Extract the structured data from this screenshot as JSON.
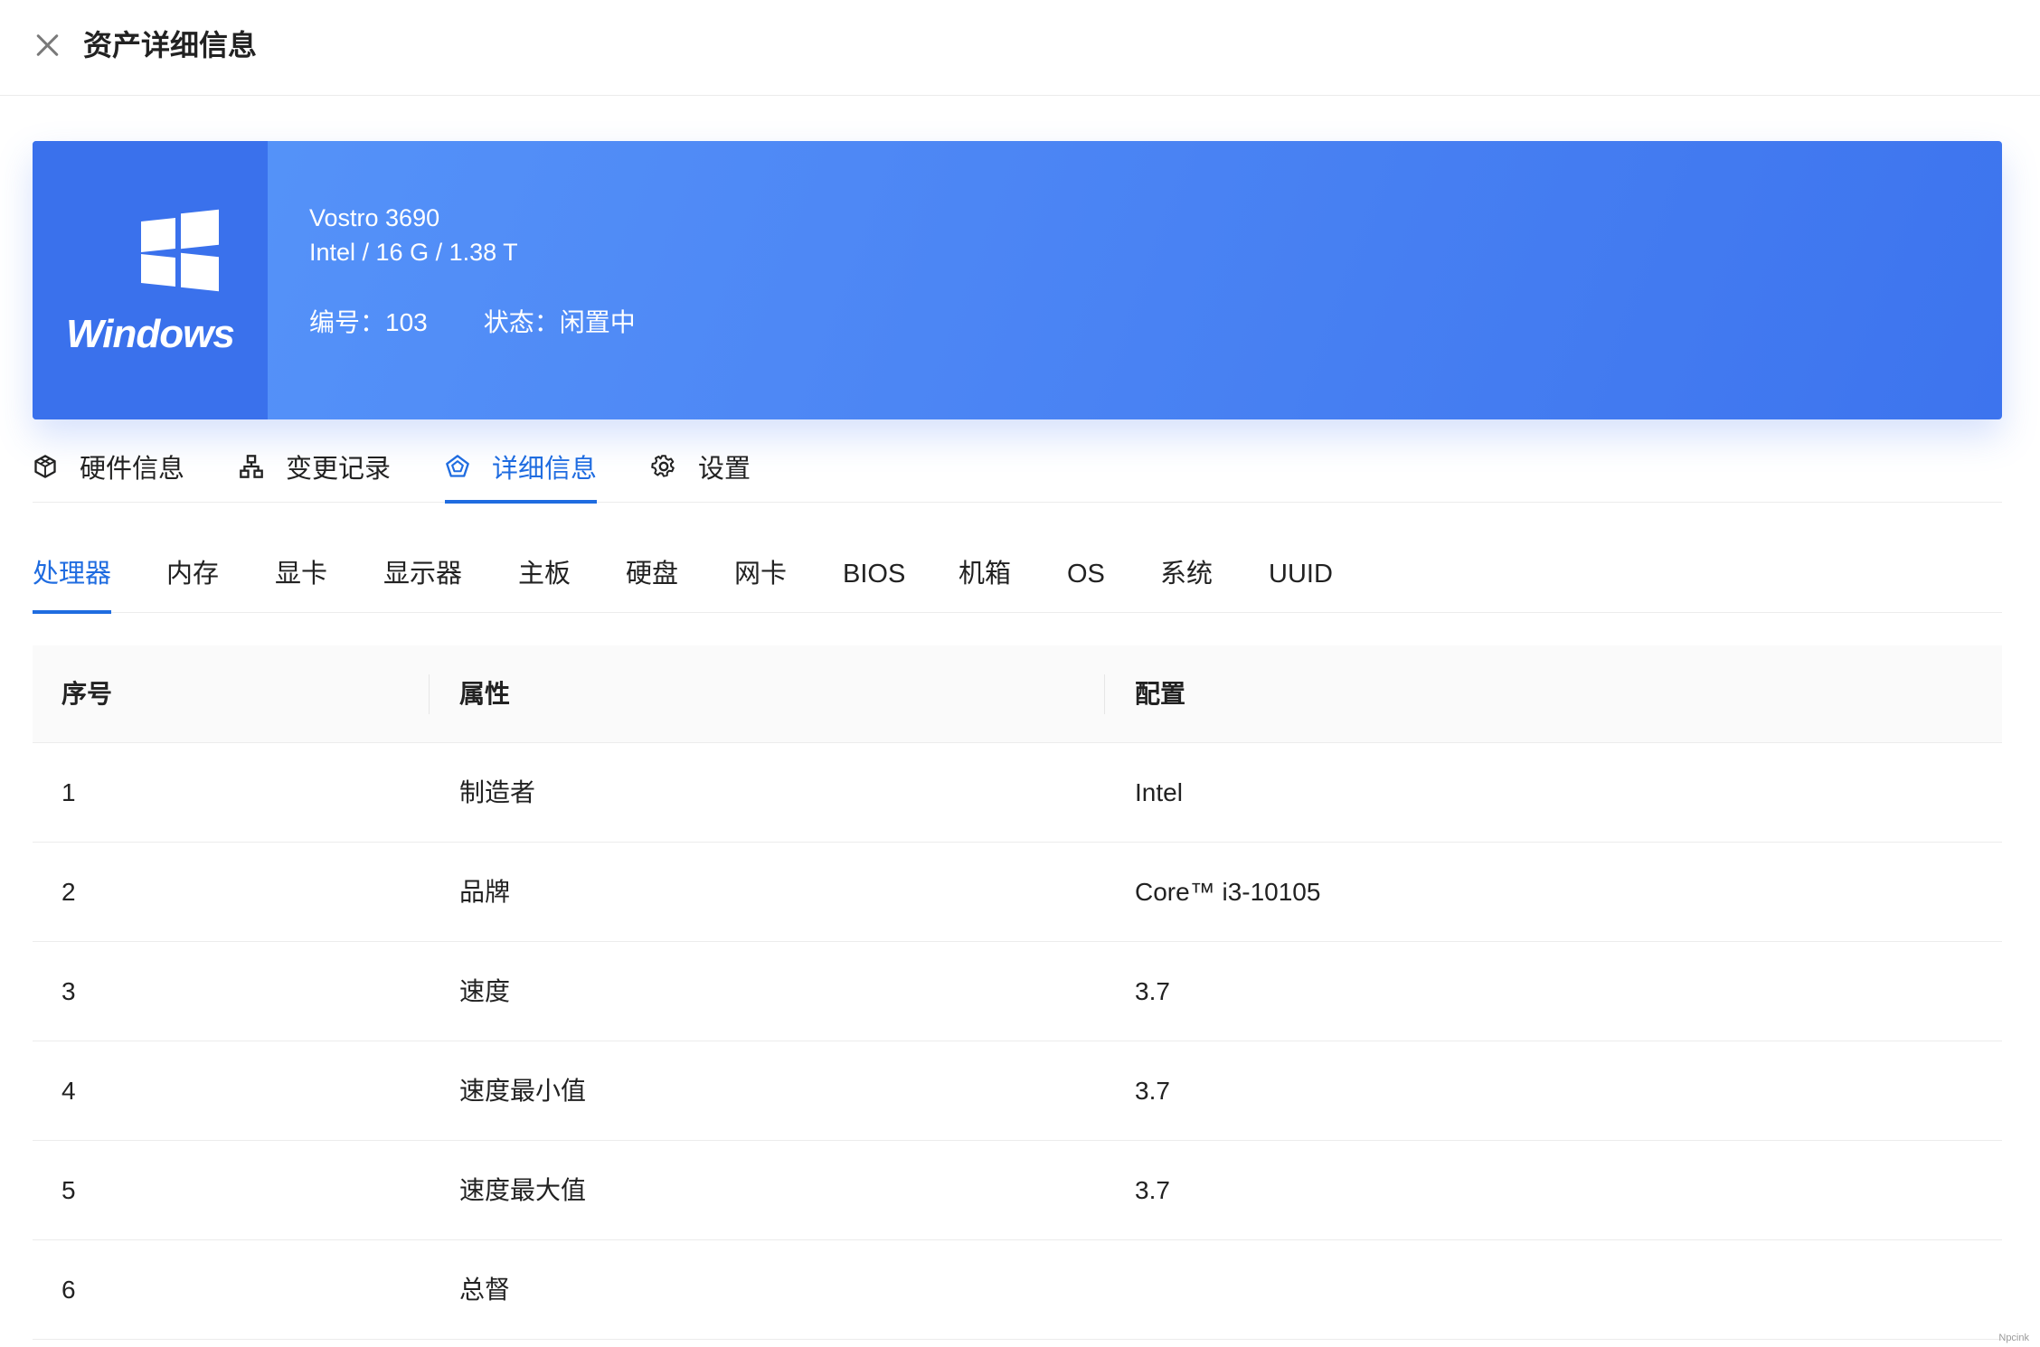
{
  "header": {
    "title": "资产详细信息"
  },
  "asset": {
    "os_name": "Windows",
    "model": "Vostro 3690",
    "spec": "Intel / 16 G / 1.38 T",
    "number_label": "编号：",
    "number_value": "103",
    "status_label": "状态：",
    "status_value": "闲置中"
  },
  "main_tabs": [
    {
      "label": "硬件信息",
      "icon": "cube-icon"
    },
    {
      "label": "变更记录",
      "icon": "hierarchy-icon"
    },
    {
      "label": "详细信息",
      "icon": "pentagon-icon",
      "active": true
    },
    {
      "label": "设置",
      "icon": "gear-icon"
    }
  ],
  "sub_tabs": [
    {
      "label": "处理器",
      "active": true
    },
    {
      "label": "内存"
    },
    {
      "label": "显卡"
    },
    {
      "label": "显示器"
    },
    {
      "label": "主板"
    },
    {
      "label": "硬盘"
    },
    {
      "label": "网卡"
    },
    {
      "label": "BIOS"
    },
    {
      "label": "机箱"
    },
    {
      "label": "OS"
    },
    {
      "label": "系统"
    },
    {
      "label": "UUID"
    }
  ],
  "table": {
    "columns": [
      "序号",
      "属性",
      "配置"
    ],
    "rows": [
      [
        "1",
        "制造者",
        "Intel"
      ],
      [
        "2",
        "品牌",
        "Core™ i3-10105"
      ],
      [
        "3",
        "速度",
        "3.7"
      ],
      [
        "4",
        "速度最小值",
        "3.7"
      ],
      [
        "5",
        "速度最大值",
        "3.7"
      ],
      [
        "6",
        "总督",
        ""
      ]
    ]
  },
  "watermark": "Npcink",
  "colors": {
    "accent": "#1f6ce0",
    "banner_start": "#5796fa",
    "banner_end": "#3d74ee",
    "os_block": "#3a71ec"
  }
}
